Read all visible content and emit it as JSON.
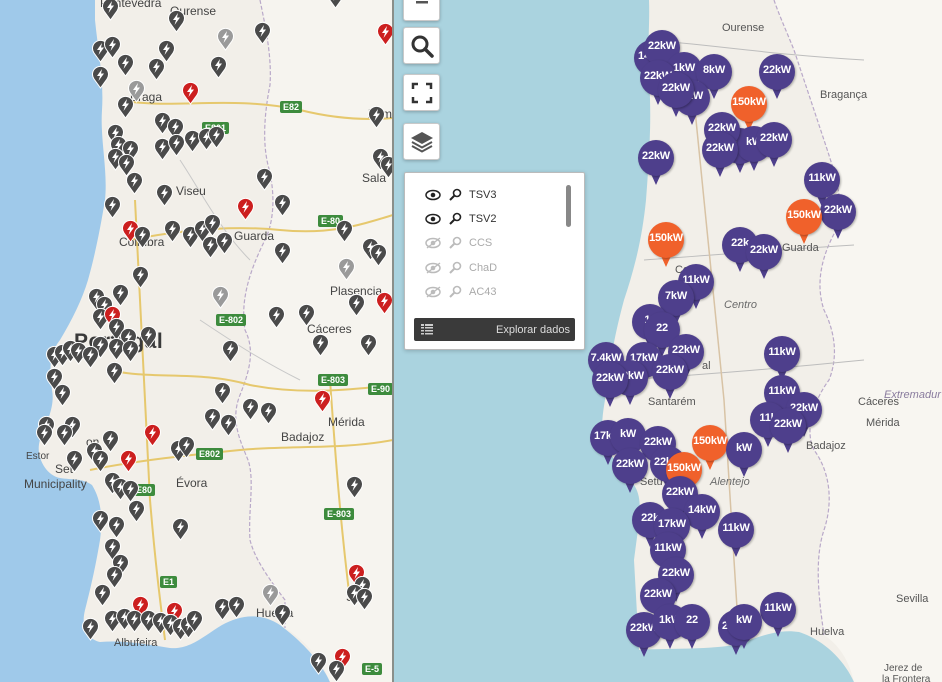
{
  "left_map": {
    "labels": {
      "pontevedra": "Pontevedra",
      "ourense": "Ourense",
      "braga": "Braga",
      "viseu": "Viseu",
      "guarda": "Guarda",
      "salamanca_partial": "Sala",
      "coimbra": "Coimbra",
      "plasencia": "Plasencia",
      "portugal_partial": "Portugal",
      "caceres": "Cáceres",
      "merida": "Mérida",
      "badajoz": "Badajoz",
      "evora": "Évora",
      "setubal_partial": "Set",
      "municipality": "Municipality",
      "estoril_partial": "Estor",
      "lisbon_partial": "on",
      "albufeira": "Albufeira",
      "huelva_partial": "Huelva",
      "sevilla_partial": "S",
      "zamora_partial": "Zam"
    },
    "roads": [
      "E82",
      "E801",
      "E-80",
      "E-802",
      "E-803",
      "E-90",
      "E802",
      "E-803",
      "E1",
      "E80",
      "E-5"
    ]
  },
  "toolbar": {
    "buttons": [
      "minus",
      "search",
      "fullscreen",
      "layers"
    ]
  },
  "layers_panel": {
    "items": [
      {
        "label": "TSV3",
        "visible": true
      },
      {
        "label": "TSV2",
        "visible": true
      },
      {
        "label": "CCS",
        "visible": false
      },
      {
        "label": "ChaD",
        "visible": false
      },
      {
        "label": "AC43",
        "visible": false
      }
    ],
    "explore_label": "Explorar dados"
  },
  "right_map": {
    "labels": {
      "ourense": "Ourense",
      "braganca": "Bragança",
      "guarda": "Guarda",
      "centro": "Centro",
      "santarem": "Santarém",
      "caceres": "Cáceres",
      "extremadura": "Extremadur",
      "merida": "Mérida",
      "badajoz": "Badajoz",
      "alentejo": "Alentejo",
      "sevilla": "Sevilla",
      "huelva": "Huelva",
      "jerez": "Jerez de",
      "jerez2": "la Frontera",
      "partial_co": "Co",
      "partial_cac": "Cá",
      "partial_setu": "Setu",
      "partial_al": "al"
    },
    "markers": [
      {
        "t": "14kW",
        "c": "purple"
      },
      {
        "t": "22kW",
        "c": "purple"
      },
      {
        "t": "1kW",
        "c": "purple"
      },
      {
        "t": "8kW",
        "c": "purple"
      },
      {
        "t": "22kW",
        "c": "purple"
      },
      {
        "t": "8kW",
        "c": "purple"
      },
      {
        "t": "150kW",
        "c": "orange"
      },
      {
        "t": "22kW",
        "c": "purple"
      },
      {
        "t": "22kW",
        "c": "purple"
      },
      {
        "t": "kW",
        "c": "purple"
      },
      {
        "t": "kW",
        "c": "purple"
      },
      {
        "t": "22kW",
        "c": "purple"
      },
      {
        "t": "22kW",
        "c": "purple"
      },
      {
        "t": "22kW",
        "c": "purple"
      },
      {
        "t": "22kW",
        "c": "purple"
      },
      {
        "t": "11kW",
        "c": "purple"
      },
      {
        "t": "150kW",
        "c": "orange"
      },
      {
        "t": "22kW",
        "c": "purple"
      },
      {
        "t": "150kW",
        "c": "orange"
      },
      {
        "t": "22k",
        "c": "purple"
      },
      {
        "t": "22kW",
        "c": "purple"
      },
      {
        "t": "11kW",
        "c": "purple"
      },
      {
        "t": "7kW",
        "c": "purple"
      },
      {
        "t": "11",
        "c": "purple"
      },
      {
        "t": "22",
        "c": "purple"
      },
      {
        "t": "22kW",
        "c": "purple"
      },
      {
        "t": "7.4kW",
        "c": "purple"
      },
      {
        "t": "17kW",
        "c": "purple"
      },
      {
        "t": "22kW",
        "c": "purple"
      },
      {
        "t": "22kW",
        "c": "purple"
      },
      {
        "t": "11kW",
        "c": "purple"
      },
      {
        "t": "22kW",
        "c": "purple"
      },
      {
        "t": "11kW",
        "c": "purple"
      },
      {
        "t": "22kW",
        "c": "purple"
      },
      {
        "t": "11k",
        "c": "purple"
      },
      {
        "t": "22kW",
        "c": "purple"
      },
      {
        "t": "17kW",
        "c": "purple"
      },
      {
        "t": "kW",
        "c": "purple"
      },
      {
        "t": "22kW",
        "c": "purple"
      },
      {
        "t": "150kW",
        "c": "orange"
      },
      {
        "t": "22kW",
        "c": "purple"
      },
      {
        "t": "22kW",
        "c": "purple"
      },
      {
        "t": "kW",
        "c": "purple"
      },
      {
        "t": "150kW",
        "c": "orange"
      },
      {
        "t": "22kW",
        "c": "purple"
      },
      {
        "t": "14kW",
        "c": "purple"
      },
      {
        "t": "22k",
        "c": "purple"
      },
      {
        "t": "17kW",
        "c": "purple"
      },
      {
        "t": "11kW",
        "c": "purple"
      },
      {
        "t": "11kW",
        "c": "purple"
      },
      {
        "t": "22kW",
        "c": "purple"
      },
      {
        "t": "22kW",
        "c": "purple"
      },
      {
        "t": "22kW",
        "c": "purple"
      },
      {
        "t": "1kW",
        "c": "purple"
      },
      {
        "t": "22",
        "c": "purple"
      },
      {
        "t": "22kW",
        "c": "purple"
      },
      {
        "t": "11kW",
        "c": "purple"
      },
      {
        "t": "kW",
        "c": "purple"
      }
    ]
  }
}
